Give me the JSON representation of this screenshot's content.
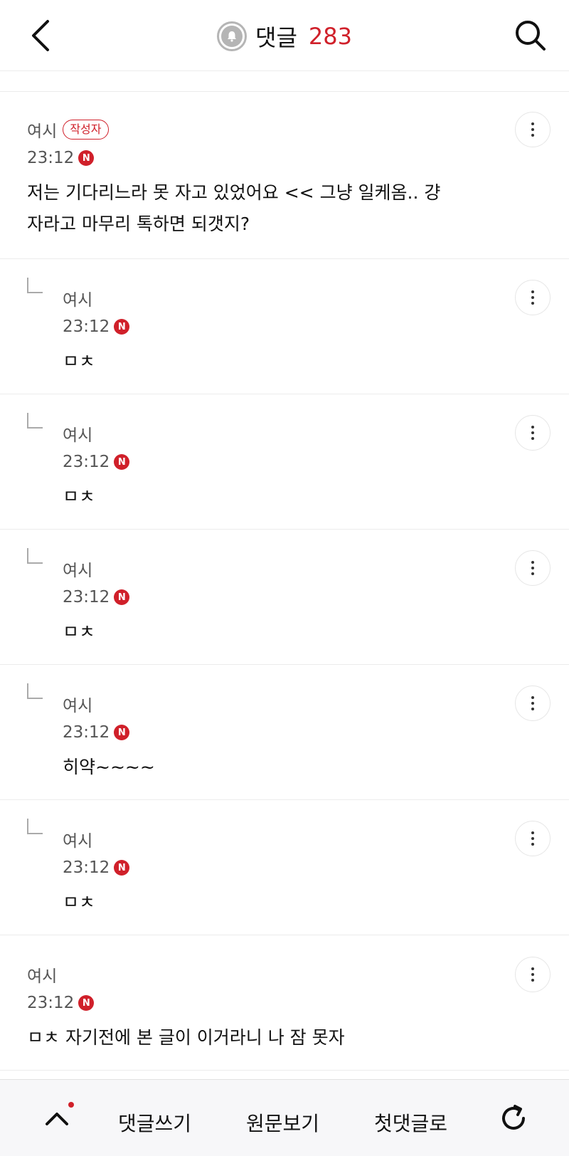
{
  "header": {
    "title": "댓글",
    "count": "283"
  },
  "comments": [
    {
      "author": "여시",
      "badge": "작성자",
      "time": "23:12",
      "new": "N",
      "text": "저는 기다리느라 못 자고 있었어요 << 그냥 일케옴.. 걍",
      "text2": "자라고 마무리 톡하면 되갯지?"
    },
    {
      "author": "여시",
      "time": "23:12",
      "new": "N",
      "text": "ㅁㅊ"
    },
    {
      "author": "여시",
      "time": "23:12",
      "new": "N",
      "text": "ㅁㅊ"
    },
    {
      "author": "여시",
      "time": "23:12",
      "new": "N",
      "text": "ㅁㅊ"
    },
    {
      "author": "여시",
      "time": "23:12",
      "new": "N",
      "text": "히약~~~~"
    },
    {
      "author": "여시",
      "time": "23:12",
      "new": "N",
      "text": "ㅁㅊ"
    },
    {
      "author": "여시",
      "time": "23:12",
      "new": "N",
      "text": "ㅁㅊ 자기전에 본 글이 이거라니 나 잠 못자"
    }
  ],
  "bottom_bar": {
    "write_label": "댓글쓰기",
    "original_label": "원문보기",
    "first_label": "첫댓글로"
  },
  "colors": {
    "accent": "#d0202a",
    "divider": "#ececec",
    "muted_text": "#555555"
  },
  "icons": [
    "back-arrow-icon",
    "bell-icon",
    "search-icon",
    "more-vertical-icon",
    "reply-indent-icon",
    "chevron-up-icon",
    "refresh-icon"
  ]
}
